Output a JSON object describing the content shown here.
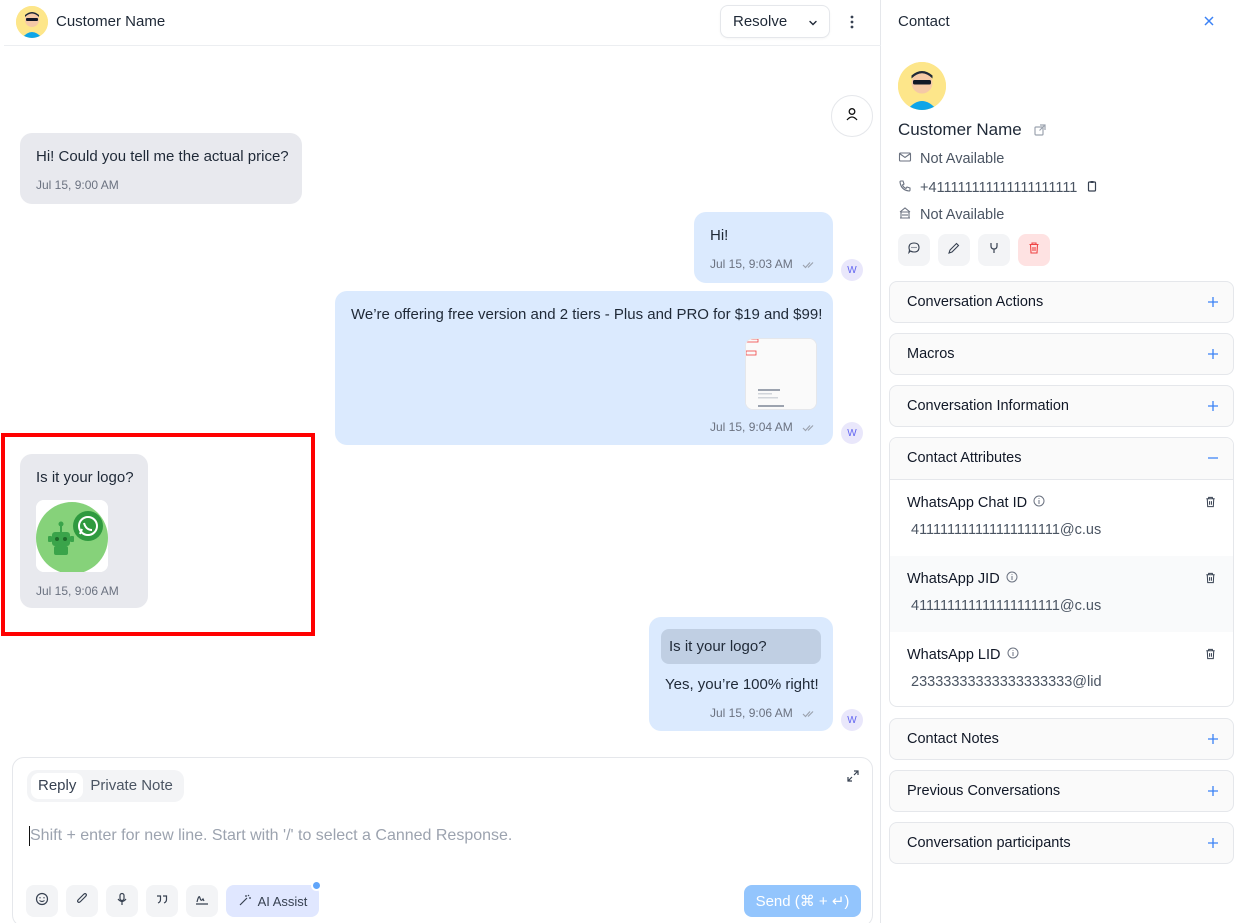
{
  "header": {
    "customer_name": "Customer Name",
    "resolve_label": "Resolve"
  },
  "messages": [
    {
      "direction": "in",
      "text": "Hi! Could you tell me the actual price?",
      "time": "Jul 15, 9:00 AM"
    },
    {
      "direction": "out",
      "text": "Hi!",
      "time": "Jul 15, 9:03 AM",
      "agent_initial": "W"
    },
    {
      "direction": "out",
      "text": "We’re offering free version and 2 tiers - Plus and PRO for $19 and $99!",
      "time": "Jul 15, 9:04 AM",
      "agent_initial": "W",
      "attachment": "screenshot-thumbnail"
    },
    {
      "direction": "in",
      "text": "Is it your logo?",
      "time": "Jul 15, 9:06 AM",
      "attachment": "whatsapp-bot-logo"
    },
    {
      "direction": "out",
      "quoted": "Is it your logo?",
      "text": "Yes, you’re 100% right!",
      "time": "Jul 15, 9:06 AM",
      "agent_initial": "W"
    }
  ],
  "composer": {
    "tabs": [
      "Reply",
      "Private Note"
    ],
    "active_tab": "Reply",
    "placeholder": "Shift + enter for new line. Start with '/' to select a Canned Response.",
    "ai_assist_label": "AI Assist",
    "send_label": "Send (⌘ + ↵)",
    "tool_icons": [
      "emoji-icon",
      "paperclip-icon",
      "microphone-icon",
      "quote-icon",
      "signature-icon"
    ]
  },
  "contact": {
    "panel_title": "Contact",
    "name": "Customer Name",
    "email": "Not Available",
    "phone": "+411111111111111111111",
    "company": "Not Available",
    "actions": [
      "chat-icon",
      "edit-icon",
      "merge-icon",
      "delete-icon"
    ]
  },
  "sections": {
    "conversation_actions": "Conversation Actions",
    "macros": "Macros",
    "conversation_information": "Conversation Information",
    "contact_attributes": "Contact Attributes",
    "contact_notes": "Contact Notes",
    "previous_conversations": "Previous Conversations",
    "conversation_participants": "Conversation participants"
  },
  "attributes": [
    {
      "label": "WhatsApp Chat ID",
      "value": "411111111111111111111@c.us"
    },
    {
      "label": "WhatsApp JID",
      "value": "411111111111111111111@c.us"
    },
    {
      "label": "WhatsApp LID",
      "value": "23333333333333333333@lid"
    }
  ],
  "colors": {
    "incoming_bubble": "#e8e9ee",
    "outgoing_bubble": "#dbeafe",
    "highlight": "#ff0000",
    "send_button": "#93c5fd",
    "accent": "#3b82f6"
  }
}
